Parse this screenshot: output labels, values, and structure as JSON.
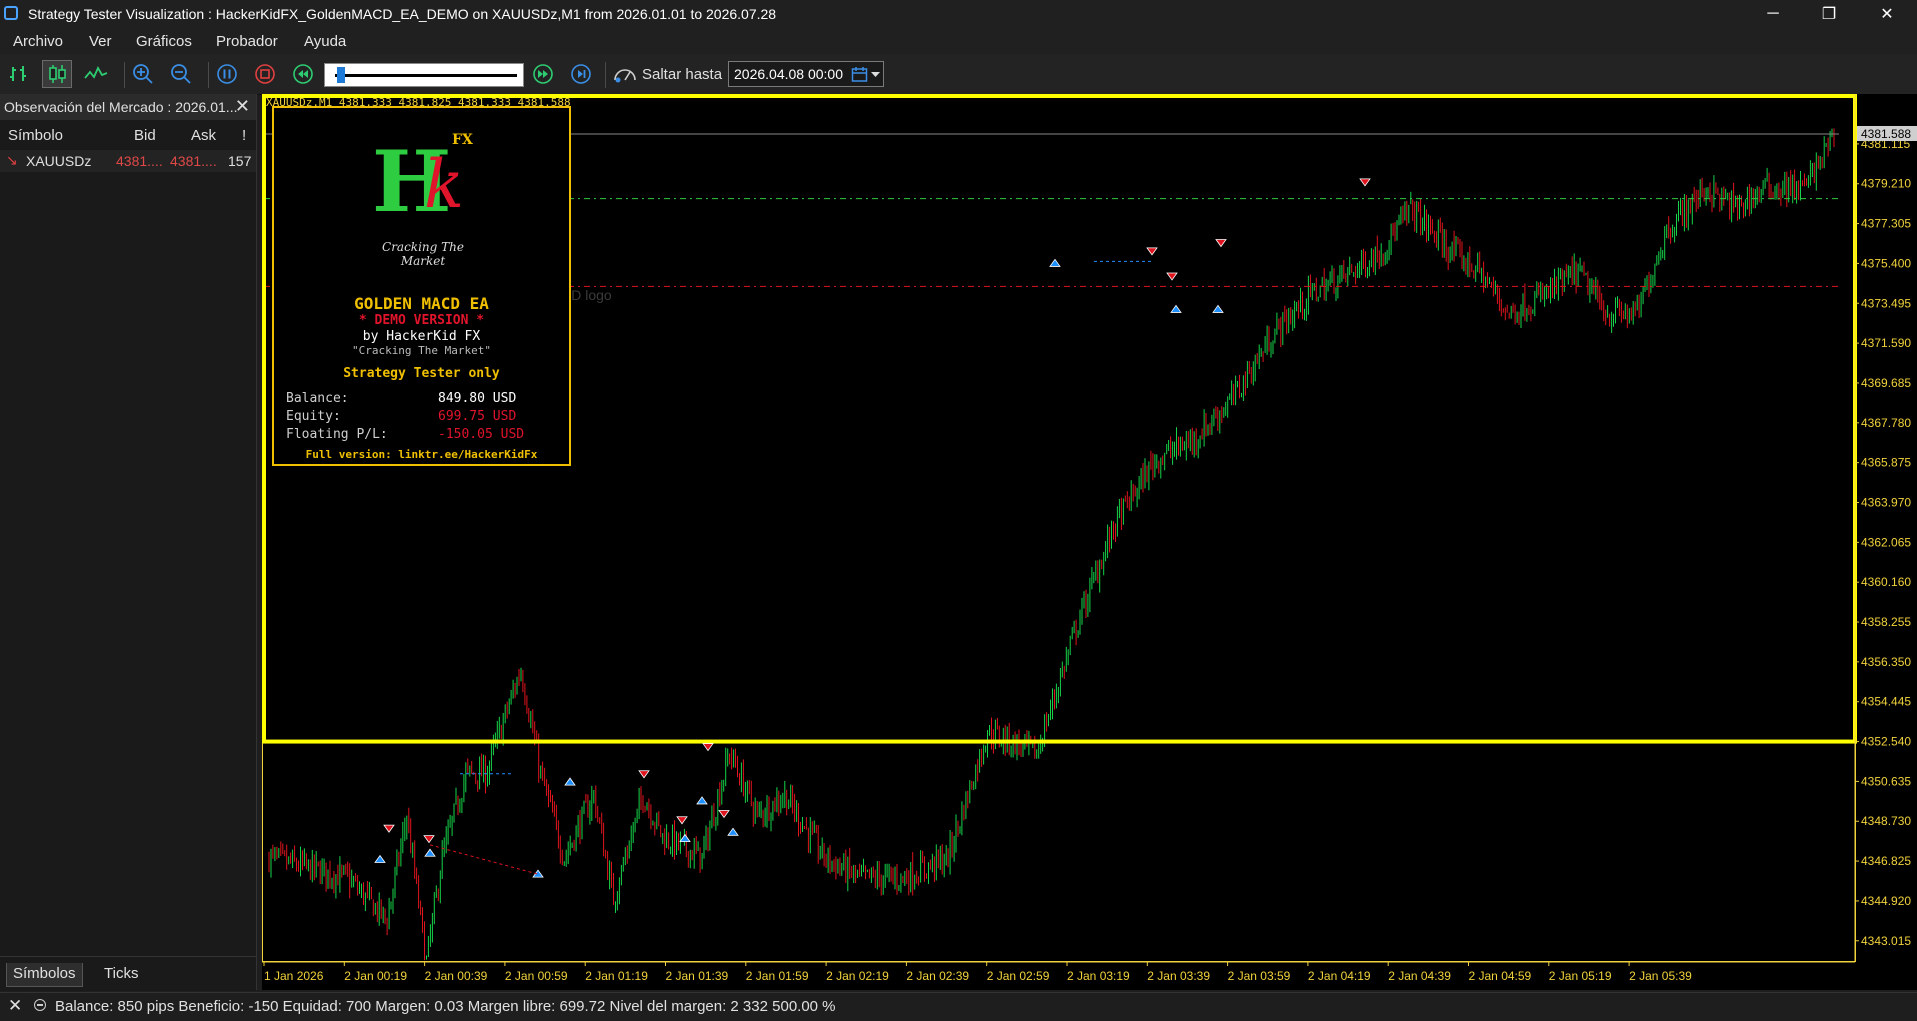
{
  "window": {
    "title": "Strategy Tester Visualization : HackerKidFX_GoldenMACD_EA_DEMO on XAUUSDz,M1 from 2026.01.01 to 2026.07.28",
    "minimize": "─",
    "maximize": "❐",
    "close": "✕"
  },
  "menu": [
    "Archivo",
    "Ver",
    "Gráficos",
    "Probador",
    "Ayuda"
  ],
  "toolbar": {
    "goto_label": "Saltar hasta",
    "goto_value": "2026.04.08 00:00",
    "slider_position": 0.03
  },
  "market_watch": {
    "title": "Observación del Mercado : 2026.01...",
    "close": "✕",
    "columns": [
      "Símbolo",
      "Bid",
      "Ask",
      "!"
    ],
    "rows": [
      {
        "arrow": "↘",
        "symbol": "XAUUSDz",
        "bid": "4381....",
        "ask": "4381....",
        "spread": "157"
      }
    ],
    "tabs": [
      "Símbolos",
      "Ticks"
    ]
  },
  "chart": {
    "header": "XAUUSDz,M1  4381.333 4381.825 4381.333 4381.588",
    "current_price": "4381.588",
    "price_labels": [
      "4381.115",
      "4379.210",
      "4377.305",
      "4375.400",
      "4373.495",
      "4371.590",
      "4369.685",
      "4367.780",
      "4365.875",
      "4363.970",
      "4362.065",
      "4360.160",
      "4358.255",
      "4356.350",
      "4354.445",
      "4352.540",
      "4350.635",
      "4348.730",
      "4346.825",
      "4344.920",
      "4343.015"
    ],
    "time_labels": [
      "1 Jan 2026",
      "2 Jan 00:19",
      "2 Jan 00:39",
      "2 Jan 00:59",
      "2 Jan 01:19",
      "2 Jan 01:39",
      "2 Jan 01:59",
      "2 Jan 02:19",
      "2 Jan 02:39",
      "2 Jan 02:59",
      "2 Jan 03:19",
      "2 Jan 03:39",
      "2 Jan 03:59",
      "2 Jan 04:19",
      "2 Jan 04:39",
      "2 Jan 04:59",
      "2 Jan 05:19",
      "2 Jan 05:39"
    ],
    "colors": {
      "bull": "#16d44a",
      "bear": "#e0141e",
      "panel_border": "#f0c000",
      "frame": "#ffff00",
      "axis": "#f0d23c"
    },
    "price_range": [
      4342.0,
      4383.5
    ],
    "levels": {
      "green_dashed": 4378.5,
      "red_dashed": 4374.3,
      "yellow_line": 4352.54
    },
    "faded_object_label": "HKFX GMACD logo",
    "faded_object_value": "4374.083"
  },
  "ea_panel": {
    "logo_letter_h": "H",
    "logo_letter_k": "k",
    "logo_fx": "FX",
    "logo_tagline": "Cracking The Market",
    "name": "GOLDEN MACD EA",
    "demo": "* DEMO VERSION *",
    "author": "by HackerKid FX",
    "tagline": "\"Cracking The Market\"",
    "mode": "Strategy Tester only",
    "balance_label": "Balance:",
    "balance_value": "849.80 USD",
    "equity_label": "Equity:",
    "equity_value": "699.75 USD",
    "floating_label": "Floating P/L:",
    "floating_value": "-150.05 USD",
    "link": "Full version: linktr.ee/HackerKidFx",
    "colors": {
      "name": "#f0c000",
      "demo": "#e0142b",
      "equity": "#e0142b",
      "link": "#f0c000"
    }
  },
  "status": {
    "close": "✕",
    "text": "Balance: 850 pips   Beneficio: -150   Equidad: 700   Margen: 0.03   Margen libre: 699.72   Nivel del margen: 2 332 500.00 %"
  }
}
